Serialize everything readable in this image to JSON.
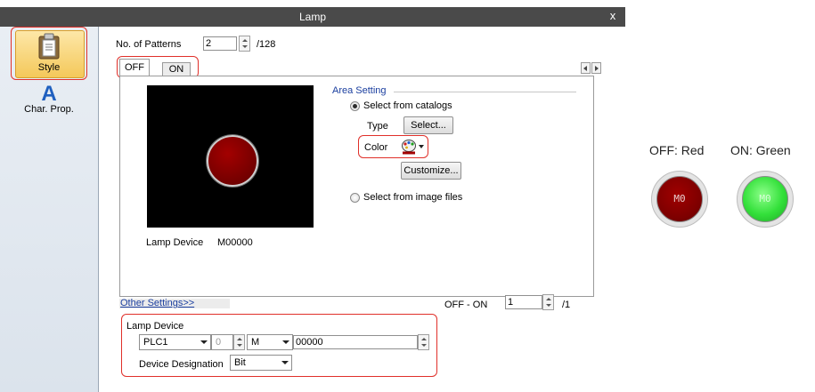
{
  "window": {
    "title": "Lamp",
    "close_glyph": "x"
  },
  "sidebar": {
    "items": [
      {
        "label": "Style",
        "icon": "clipboard-icon",
        "selected": true
      },
      {
        "label": "Char. Prop.",
        "icon": "letter-a-icon",
        "selected": false
      }
    ]
  },
  "patterns": {
    "label": "No. of Patterns",
    "value": "2",
    "max": "/128"
  },
  "tabs": [
    {
      "label": "OFF",
      "active": true
    },
    {
      "label": "ON",
      "active": false
    }
  ],
  "preview": {
    "lamp_device_label": "Lamp Device",
    "lamp_device_value": "M00000"
  },
  "area": {
    "heading": "Area Setting",
    "catalog_radio": "Select from catalogs",
    "type_label": "Type",
    "select_button": "Select...",
    "color_label": "Color",
    "customize_button": "Customize...",
    "image_radio": "Select from image files"
  },
  "other_settings": {
    "link": "Other Settings>>",
    "offon_label": "OFF - ON",
    "offon_value": "1",
    "offon_max": "/1"
  },
  "lamp_device": {
    "heading": "Lamp Device",
    "plc": "PLC1",
    "station": "0",
    "device_type": "M",
    "address": "00000",
    "designation_label": "Device Designation",
    "designation_value": "Bit"
  },
  "legend": {
    "off_label": "OFF: Red",
    "on_label": "ON: Green",
    "off_text": "M0",
    "on_text": "M0"
  },
  "colors": {
    "lamp_off": "#8b0000",
    "lamp_on": "#33e03a",
    "highlight": "#e0302a",
    "title_bar": "#4a4a4a"
  }
}
